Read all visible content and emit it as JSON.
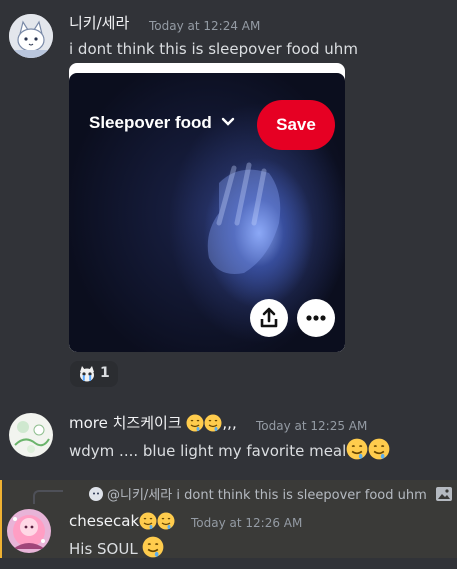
{
  "messages": [
    {
      "username": "니키/세라",
      "timestamp": "Today at 12:24 AM",
      "text": "i dont think this is sleepover food uhm",
      "embed": {
        "board_label": "Sleepover food",
        "save_label": "Save"
      },
      "reaction": {
        "emoji": "crying-cat-emoji",
        "count": "1"
      }
    },
    {
      "username": "more 치즈케이크",
      "username_suffix": ",,,",
      "timestamp": "Today at 12:25 AM",
      "text": "wdym .... blue light my favorite meal"
    },
    {
      "reply_to": {
        "mention": "@니키/세라",
        "text": "i dont think this is sleepover food uhm"
      },
      "username": "chesecak",
      "timestamp": "Today at 12:26 AM",
      "text": "His SOUL"
    }
  ],
  "colors": {
    "background": "#313338",
    "highlight": "#3a3a38",
    "accent": "#f0b232",
    "save_red": "#e60023"
  }
}
